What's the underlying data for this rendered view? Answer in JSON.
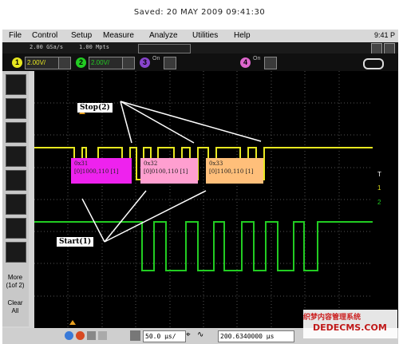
{
  "saved_line": "Saved:  20 MAY 2009  09:41:30",
  "menubar": {
    "items": [
      "File",
      "Control",
      "Setup",
      "Measure",
      "Analyze",
      "Utilities",
      "Help"
    ],
    "clock": "9:41 P"
  },
  "status": {
    "sample_rate": "2.00 GSa/s",
    "points": "1.00 Mpts"
  },
  "channels": {
    "ch1": {
      "number": "1",
      "scale": "2.00V/",
      "color": "#e8e820"
    },
    "ch2": {
      "number": "2",
      "scale": "2.00V/",
      "color": "#22cc22"
    },
    "ch3": {
      "number": "3",
      "on_label": "On",
      "color": "#8844cc"
    },
    "ch4": {
      "number": "4",
      "on_label": "On",
      "color": "#dd66cc"
    }
  },
  "sidebar": {
    "more_label": "More\n(1of 2)",
    "clear_label": "Clear\nAll"
  },
  "timebase": {
    "scale": "50.0 µs/",
    "position": "200.6340000 µs"
  },
  "annotations": {
    "stop": "Stop(2)",
    "start": "Start(1)"
  },
  "decode_boxes": [
    {
      "hex": "0x31",
      "bits": "[0]1000,110 [1]",
      "color": "#ee22ee"
    },
    {
      "hex": "0x32",
      "bits": "[0]0100,110  [1]",
      "color": "#ff9fd0"
    },
    {
      "hex": "0x33",
      "bits": "[0]1100,110  [1]",
      "color": "#ffbf7a"
    }
  ],
  "right_markers": {
    "t": "T",
    "ch1": "1",
    "ch2": "2"
  },
  "watermark": {
    "cn": "织梦内容管理系统",
    "en": "DEDECMS.COM"
  },
  "colors": {
    "ch1": "#e8e820",
    "ch2": "#22cc22"
  }
}
